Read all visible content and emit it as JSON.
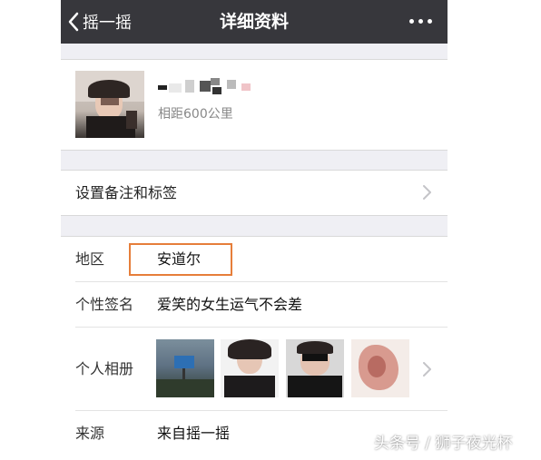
{
  "navbar": {
    "back_label": "摇一摇",
    "title": "详细资料"
  },
  "profile": {
    "distance": "相距600公里"
  },
  "remark": {
    "label": "设置备注和标签"
  },
  "info": {
    "region": {
      "label": "地区",
      "value": "安道尔"
    },
    "signature": {
      "label": "个性签名",
      "value": "爱笑的女生运气不会差"
    },
    "album": {
      "label": "个人相册"
    },
    "source": {
      "label": "来源",
      "value": "来自摇一摇"
    }
  },
  "watermark": "头条号 / 狮子夜光杯",
  "colors": {
    "navbar_bg": "#37373c",
    "page_bg": "#efeff4",
    "highlight_border": "#e67e3a"
  },
  "icons": [
    "chevron-left-icon",
    "more-dots-icon",
    "chevron-right-icon"
  ]
}
